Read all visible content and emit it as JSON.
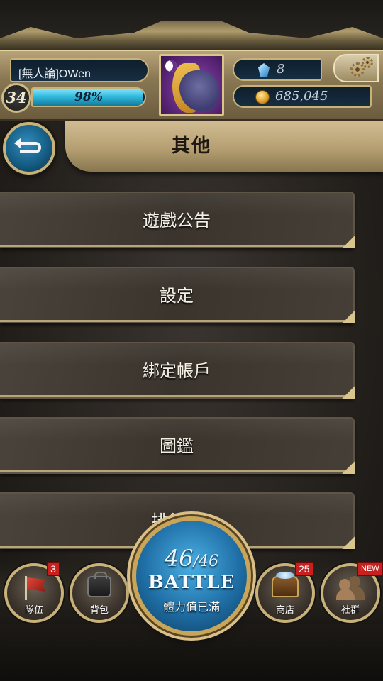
{
  "player": {
    "name": "[無人論]OWen",
    "level": "34",
    "exp_label": "98%",
    "exp_fraction": 0.98,
    "gems": "8",
    "gold": "685,045"
  },
  "header": {
    "title": "其他"
  },
  "menu": {
    "items": [
      {
        "label": "遊戲公告"
      },
      {
        "label": "設定"
      },
      {
        "label": "綁定帳戶"
      },
      {
        "label": "圖鑑"
      },
      {
        "label": "排行榜"
      }
    ]
  },
  "battle": {
    "stamina_current": "46",
    "stamina_max": "/46",
    "label": "BATTLE",
    "status": "體力值已滿"
  },
  "nav": {
    "team": {
      "label": "隊伍",
      "badge": "3"
    },
    "bag": {
      "label": "背包"
    },
    "shop": {
      "label": "商店",
      "badge": "25"
    },
    "social": {
      "label": "社群",
      "badge": "NEW"
    }
  },
  "colors": {
    "accent_gold": "#c9b27a",
    "exp_cyan": "#2fb6d9",
    "badge_red": "#c81f1f",
    "battle_blue": "#1f6fa6"
  },
  "icons": [
    "back-arrow-icon",
    "settings-gear-icon",
    "gem-icon",
    "coin-icon",
    "flag-icon",
    "bag-icon",
    "chest-icon",
    "people-icon"
  ]
}
